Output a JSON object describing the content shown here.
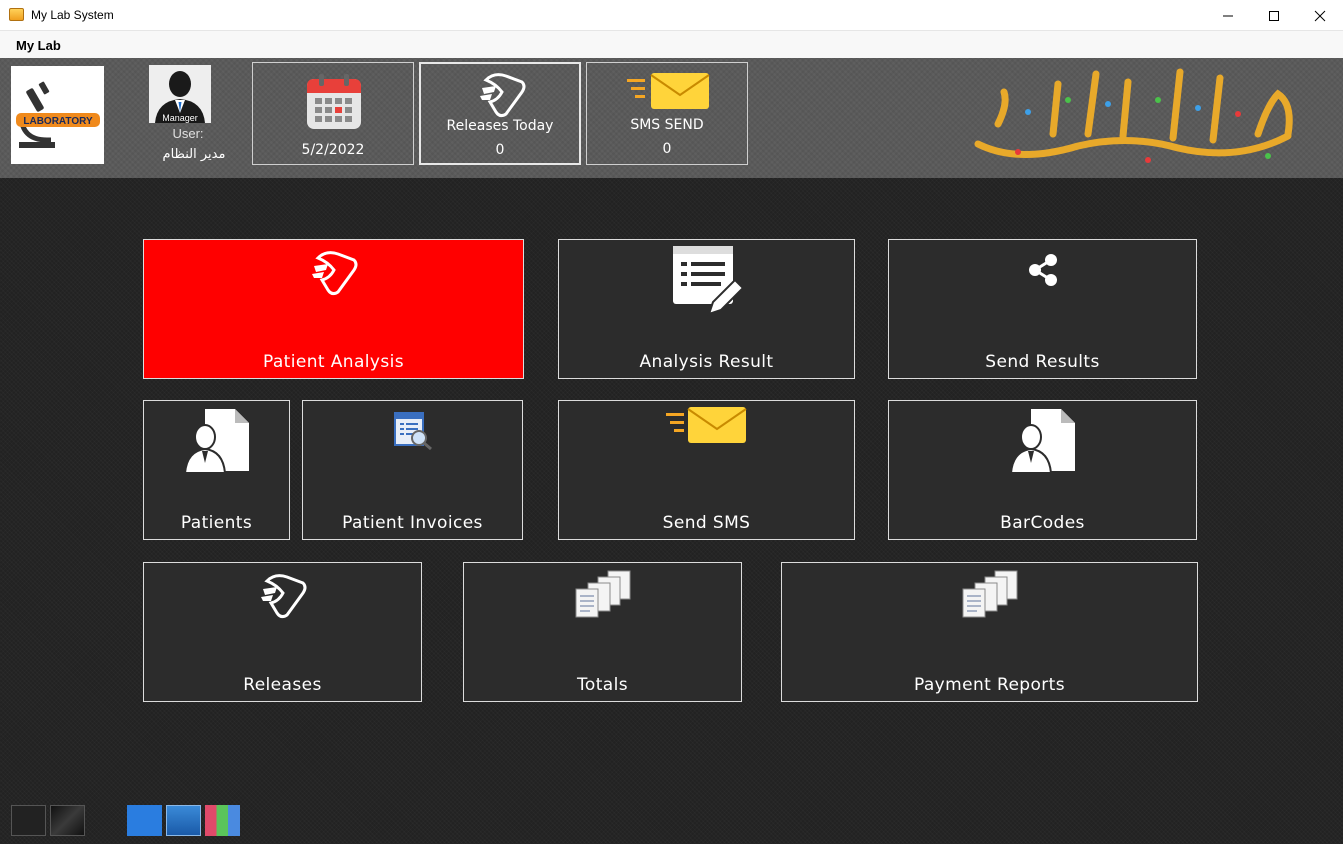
{
  "window": {
    "title": "My Lab System"
  },
  "menu": {
    "items": [
      "My Lab"
    ]
  },
  "header": {
    "logo_text": "LABORATORY",
    "avatar_label": "Manager",
    "user_caption": "User:",
    "user_name": "مدير النظام",
    "date": "5/2/2022",
    "releases_today": {
      "label": "Releases Today",
      "value": "0"
    },
    "sms_send": {
      "label": "SMS SEND",
      "value": "0"
    }
  },
  "tiles": {
    "patient_analysis": "Patient Analysis",
    "analysis_result": "Analysis Result",
    "send_results": "Send Results",
    "patients": "Patients",
    "patient_invoices": "Patient Invoices",
    "send_sms": "Send SMS",
    "barcodes": "BarCodes",
    "releases": "Releases",
    "totals": "Totals",
    "payment_reports": "Payment Reports"
  },
  "colors": {
    "active_tile": "#ff0000",
    "tile_bg": "#2c2c2c",
    "header_bg": "#5a5a5a"
  }
}
